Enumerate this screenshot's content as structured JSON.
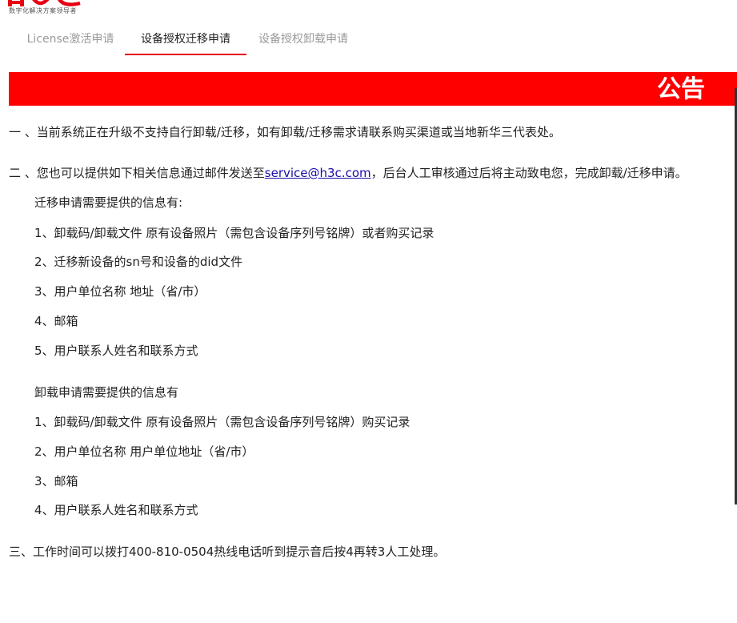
{
  "logo": {
    "tagline": "数字化解决方案领导者",
    "brand_color": "#e60012"
  },
  "tabs": [
    {
      "label": "License激活申请",
      "active": false
    },
    {
      "label": "设备授权迁移申请",
      "active": true
    },
    {
      "label": "设备授权卸载申请",
      "active": false
    }
  ],
  "banner": {
    "title": "公告",
    "color": "#ff0000"
  },
  "notice": {
    "item1": "一 、当前系统正在升级不支持自行卸载/迁移，如有卸载/迁移需求请联系购买渠道或当地新华三代表处。",
    "item2_prefix": "二 、您也可以提供如下相关信息通过邮件发送至",
    "item2_email": "service@h3c.com",
    "item2_suffix": "，后台人工审核通过后将主动致电您，完成卸载/迁移申请。",
    "migration": {
      "heading": "迁移申请需要提供的信息有:",
      "items": [
        "1、卸载码/卸载文件 原有设备照片（需包含设备序列号铭牌）或者购买记录",
        "2、迁移新设备的sn号和设备的did文件",
        "3、用户单位名称 地址（省/市）",
        "4、邮箱",
        "5、用户联系人姓名和联系方式"
      ]
    },
    "uninstall": {
      "heading": "卸载申请需要提供的信息有",
      "items": [
        "1、卸载码/卸载文件 原有设备照片（需包含设备序列号铭牌）购买记录",
        "2、用户单位名称 用户单位地址（省/市）",
        "3、邮箱",
        "4、用户联系人姓名和联系方式"
      ]
    },
    "item3": "三、工作时间可以拨打400-810-0504热线电话听到提示音后按4再转3人工处理。"
  }
}
